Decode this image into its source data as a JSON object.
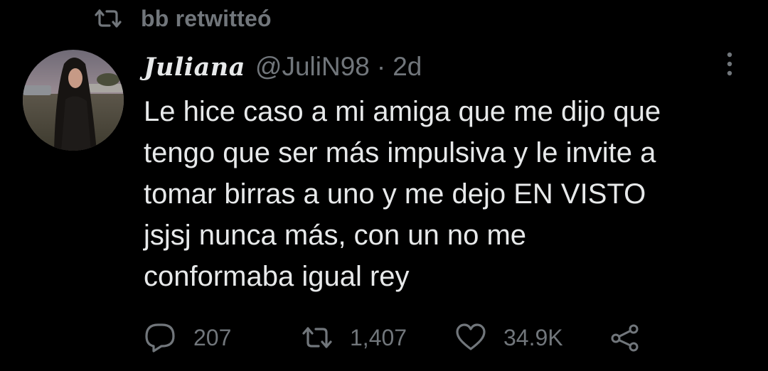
{
  "retweet_banner": {
    "icon": "retweet-icon",
    "text": "bb retwitteó"
  },
  "tweet": {
    "avatar_icon": "profile-photo",
    "display_name": "Juliana",
    "handle": "@JuliN98",
    "separator": "·",
    "time": "2d",
    "text_lines": [
      "Le hice caso a mi amiga que me dijo que",
      "tengo que ser más impulsiva y le invite a",
      "tomar birras a uno y me dejo EN VISTO",
      "jsjsj nunca más, con un no me",
      "conformaba igual rey"
    ],
    "more_icon": "more-vertical-icon"
  },
  "actions": {
    "reply": {
      "icon": "reply-icon",
      "count": "207"
    },
    "retweet": {
      "icon": "retweet-icon",
      "count": "1,407"
    },
    "like": {
      "icon": "heart-icon",
      "count": "34.9K"
    },
    "share": {
      "icon": "share-icon"
    }
  },
  "colors": {
    "background": "#000000",
    "primary_text": "#e7e9ea",
    "secondary_text": "#71767b"
  }
}
